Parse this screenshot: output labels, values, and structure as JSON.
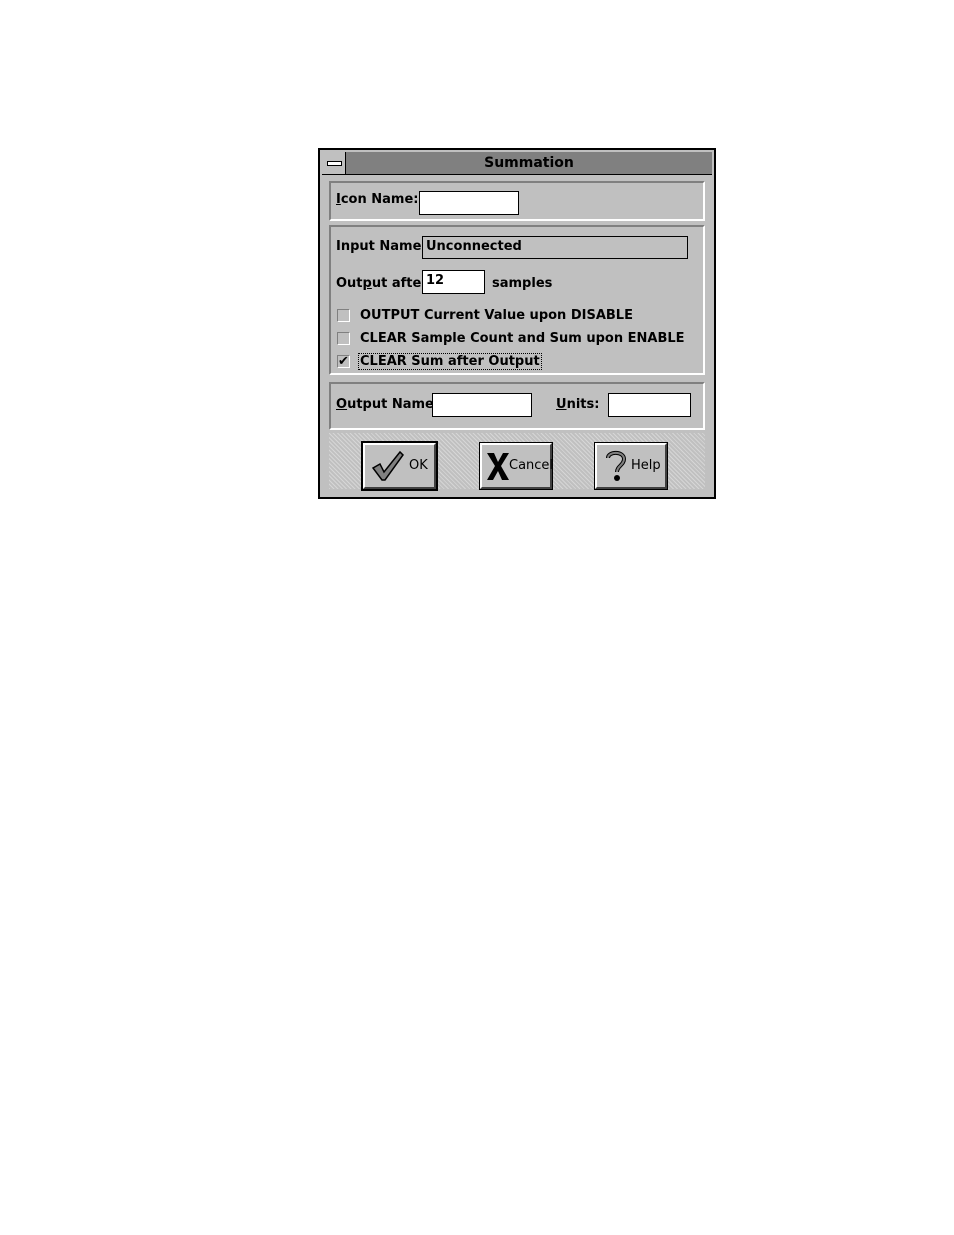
{
  "dialog": {
    "title": "Summation",
    "icon_name": {
      "label_first": "I",
      "label_rest": "con Name:",
      "value": ""
    },
    "input_name": {
      "label": "Input Name:",
      "value": "Unconnected"
    },
    "output_after": {
      "label_a": "Out",
      "label_u": "p",
      "label_b": "ut after",
      "value": "12",
      "suffix": "samples"
    },
    "checkboxes": [
      {
        "label": "OUTPUT Current Value upon DISABLE",
        "checked": false,
        "mark": ""
      },
      {
        "label": "CLEAR Sample Count and Sum upon ENABLE",
        "checked": false,
        "mark": ""
      },
      {
        "label": "CLEAR Sum after Output",
        "checked": true,
        "mark": "✔"
      }
    ],
    "output_name": {
      "label_first": "O",
      "label_rest": "utput Name:",
      "value": ""
    },
    "units": {
      "label_first": "U",
      "label_rest": "nits:",
      "value": ""
    },
    "buttons": {
      "ok": "OK",
      "cancel": "Cancel",
      "help": "Help"
    }
  }
}
